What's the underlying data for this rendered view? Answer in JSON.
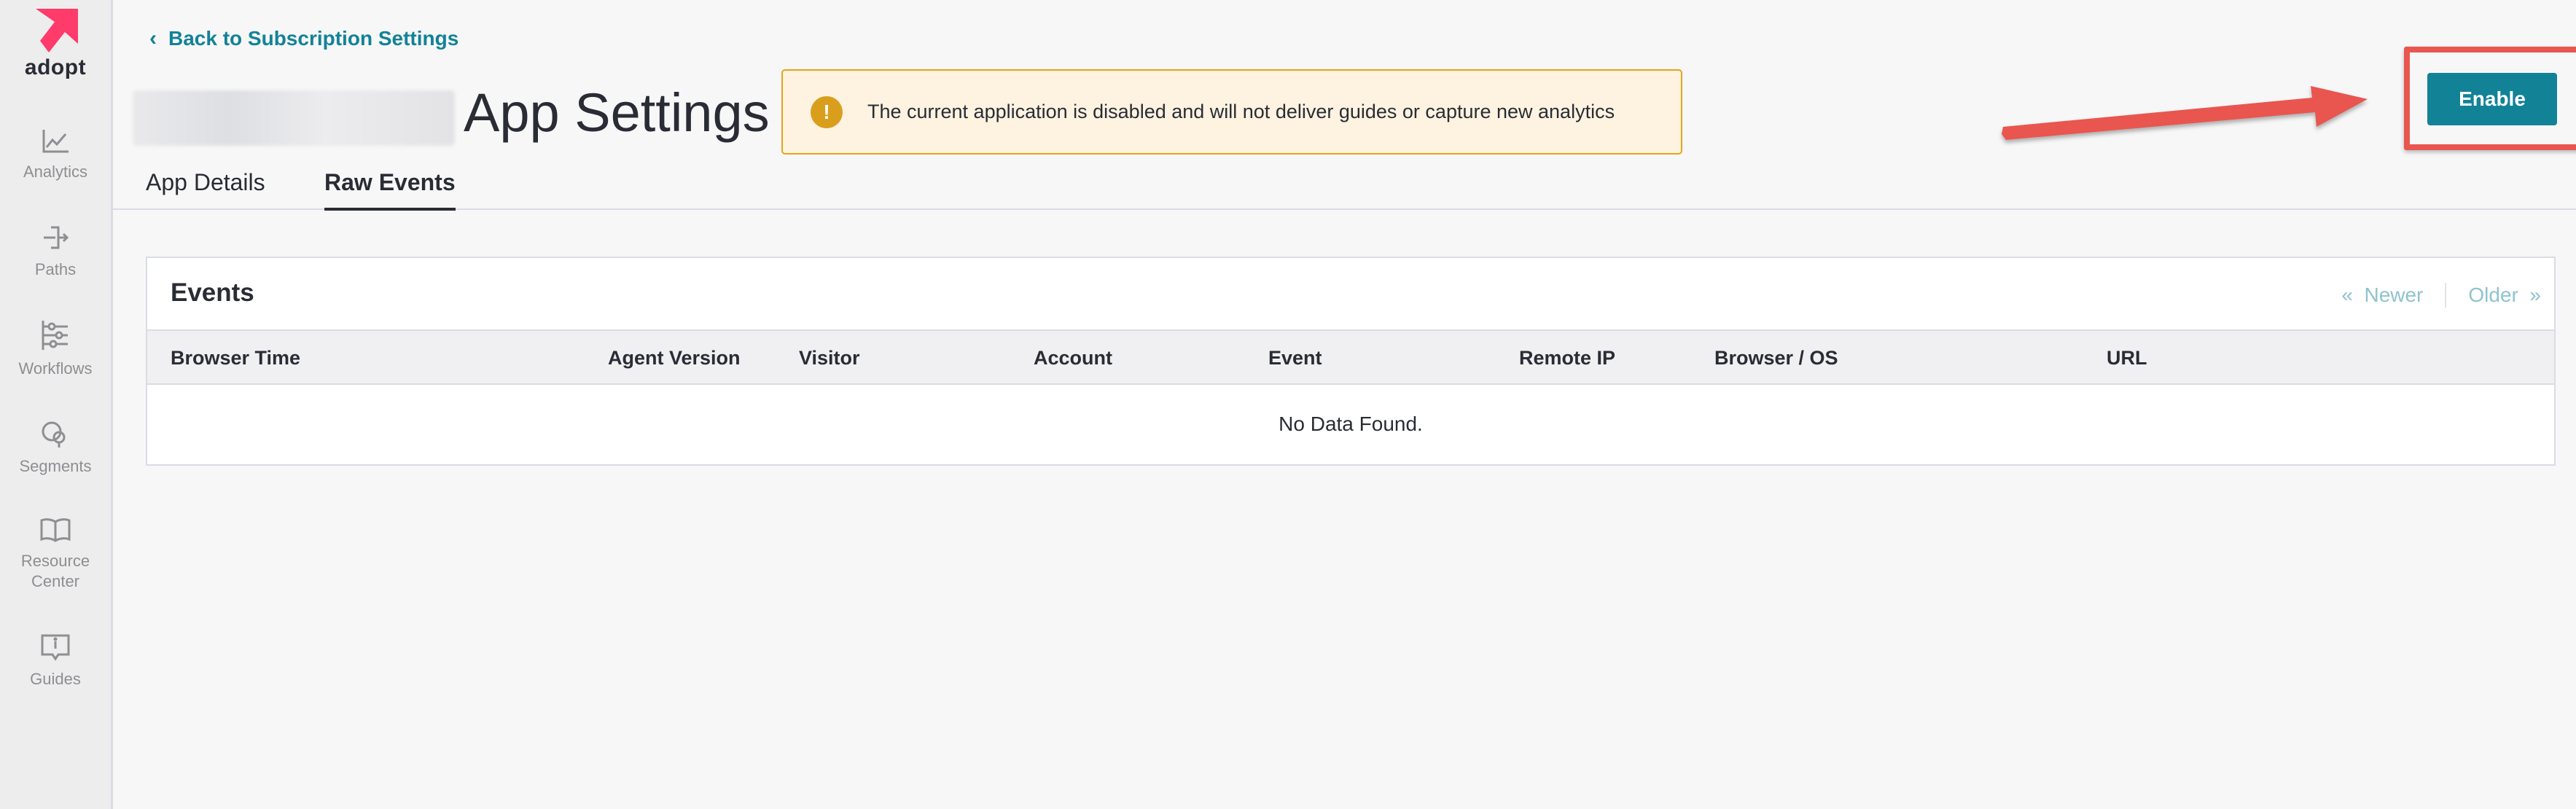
{
  "colors": {
    "accent": "#128297",
    "brand": "#fe3b6b",
    "warning": "#d99f1c",
    "annotation": "#e8564f"
  },
  "sidebar": {
    "brand_name": "adopt",
    "items": [
      {
        "label": "Analytics",
        "icon": "analytics-icon"
      },
      {
        "label": "Paths",
        "icon": "paths-icon"
      },
      {
        "label": "Workflows",
        "icon": "workflows-icon"
      },
      {
        "label": "Segments",
        "icon": "segments-icon"
      },
      {
        "label": "Resource Center",
        "icon": "resource-center-icon"
      },
      {
        "label": "Guides",
        "icon": "guides-icon"
      }
    ]
  },
  "header": {
    "back_label": "Back to Subscription Settings",
    "title": "App Settings",
    "alert_icon": "!",
    "alert_text": "The current application is disabled and will not deliver guides or capture new analytics",
    "enable_label": "Enable"
  },
  "tabs": [
    {
      "label": "App Details",
      "active": false
    },
    {
      "label": "Raw Events",
      "active": true
    }
  ],
  "events": {
    "title": "Events",
    "pager_newer": "Newer",
    "pager_older": "Older",
    "columns": [
      "Browser Time",
      "Agent Version",
      "Visitor",
      "Account",
      "Event",
      "Remote IP",
      "Browser / OS",
      "URL"
    ],
    "empty_text": "No Data Found."
  }
}
